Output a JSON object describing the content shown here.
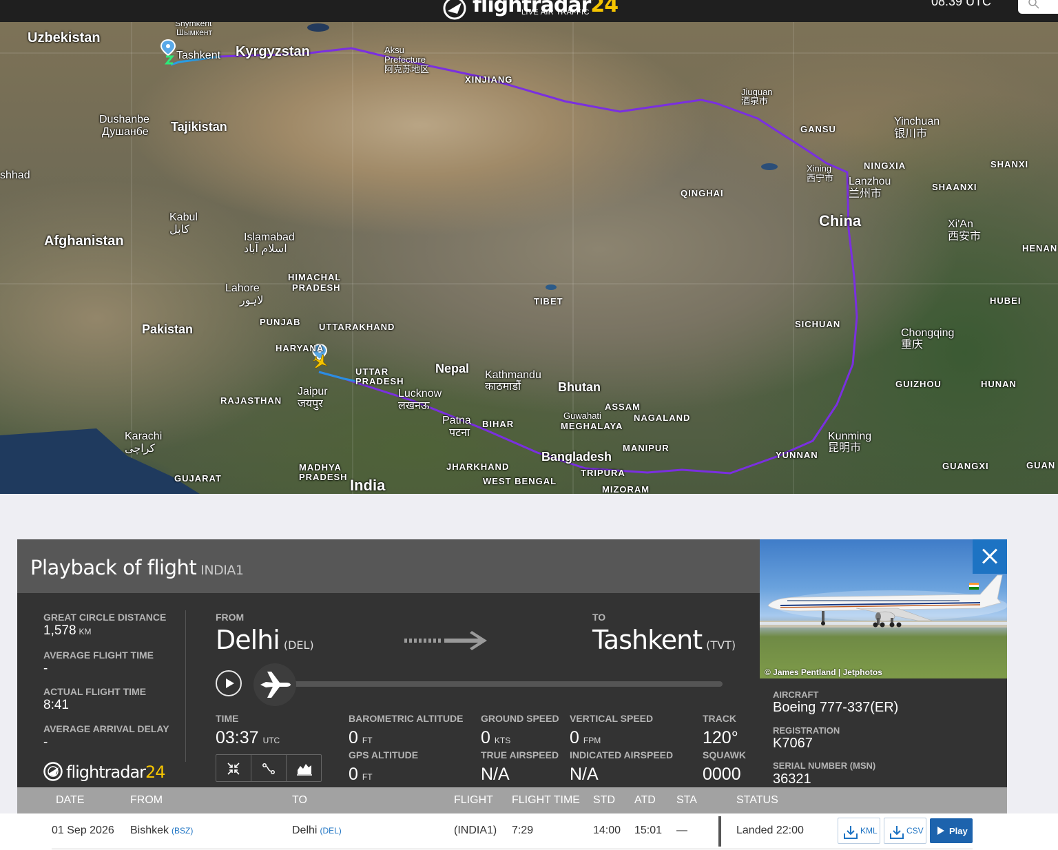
{
  "header": {
    "logo_main": "flightradar",
    "logo_num": "24",
    "logo_sub": "LIVE AIR TRAFFIC",
    "utc_time": "08:39 UTC"
  },
  "map": {
    "labels": {
      "uzbekistan": "Uzbekistan",
      "shymkent": "Shymkent",
      "shymkent_ru": "Шымкент",
      "tashkent": "Tashkent",
      "kyrgyzstan": "Kyrgyzstan",
      "aksu": "Aksu",
      "aksu_pref": "Prefecture",
      "aksu_cn": "阿克苏地区",
      "xinjiang": "XINJIANG",
      "jiuquan": "Jiuquan",
      "jiuquan_cn": "酒泉市",
      "gansu": "GANSU",
      "yinchuan": "Yinchuan",
      "yinchuan_cn": "银川市",
      "dushanbe": "Dushanbe",
      "dushanbe_ru": "Душанбе",
      "tajikistan": "Tajikistan",
      "xining": "Xining",
      "xining_cn": "西宁市",
      "ningxia": "NINGXIA",
      "lanzhou": "Lanzhou",
      "lanzhou_cn": "兰州市",
      "shanxi": "SHANXI",
      "shaanxi": "SHAANXI",
      "mashhad": "shhad",
      "qinghai": "QINGHAI",
      "china": "China",
      "xian": "Xi'An",
      "xian_cn": "西安市",
      "henan": "HENAN",
      "kabul": "Kabul",
      "kabul_local": "کابل",
      "afghanistan": "Afghanistan",
      "islamabad": "Islamabad",
      "islamabad_local": "اسلام آباد",
      "himachal": "HIMACHAL",
      "pradesh1": "PRADESH",
      "lahore": "Lahore",
      "lahore_local": "لاہور",
      "tibet": "TIBET",
      "hubei": "HUBEI",
      "punjab": "PUNJAB",
      "uttarakhand": "UTTARAKHAND",
      "pakistan": "Pakistan",
      "sichuan": "SICHUAN",
      "chongqing": "Chongqing",
      "chongqing_cn": "重庆",
      "haryana": "HARYANA",
      "uttar": "UTTAR",
      "pradesh2": "PRADESH",
      "nepal": "Nepal",
      "kathmandu": "Kathmandu",
      "kathmandu_local": "काठमाडौं",
      "bhutan": "Bhutan",
      "rajasthan": "RAJASTHAN",
      "jaipur": "Jaipur",
      "jaipur_local": "जयपुर",
      "lucknow": "Lucknow",
      "lucknow_local": "लखनऊ",
      "guizhou": "GUIZHOU",
      "hunan": "HUNAN",
      "assam": "ASSAM",
      "guwahati": "Guwahati",
      "nagaland": "NAGALAND",
      "meghalaya": "MEGHALAYA",
      "karachi": "Karachi",
      "karachi_local": "کراچی",
      "patna": "Patna",
      "patna_local": "पटना",
      "bihar": "BIHAR",
      "kunming": "Kunming",
      "kunming_cn": "昆明市",
      "manipur": "MANIPUR",
      "bangladesh": "Bangladesh",
      "yunnan": "YUNNAN",
      "guangxi": "GUANGXI",
      "guang": "GUAN",
      "madhya": "MADHYA",
      "pradesh3": "PRADESH",
      "jharkhand": "JHARKHAND",
      "tripura": "TRIPURA",
      "gujarat": "GUJARAT",
      "india": "India",
      "west_bengal": "WEST BENGAL",
      "mizoram": "MIZORAM"
    }
  },
  "panel": {
    "title": "Playback of flight",
    "flight_id": "INDIA1",
    "stats": [
      {
        "label": "GREAT CIRCLE DISTANCE",
        "value": "1,578",
        "unit": "KM"
      },
      {
        "label": "AVERAGE FLIGHT TIME",
        "value": "-",
        "unit": ""
      },
      {
        "label": "ACTUAL FLIGHT TIME",
        "value": "8:41",
        "unit": ""
      },
      {
        "label": "AVERAGE ARRIVAL DELAY",
        "value": "-",
        "unit": ""
      }
    ],
    "brand": {
      "main": "flightradar",
      "num": "24"
    },
    "from_label": "FROM",
    "from_city": "Delhi",
    "from_code": "(DEL)",
    "to_label": "TO",
    "to_city": "Tashkent",
    "to_code": "(TVT)",
    "playback_progress": 0,
    "telemetry": {
      "time_label": "TIME",
      "time_value": "03:37",
      "time_unit": "UTC",
      "baro_label": "BAROMETRIC ALTITUDE",
      "baro_value": "0",
      "baro_unit": "FT",
      "gps_label": "GPS ALTITUDE",
      "gps_value": "0",
      "gps_unit": "FT",
      "gs_label": "GROUND SPEED",
      "gs_value": "0",
      "gs_unit": "KTS",
      "tas_label": "TRUE AIRSPEED",
      "tas_value": "N/A",
      "vs_label": "VERTICAL SPEED",
      "vs_value": "0",
      "vs_unit": "FPM",
      "ias_label": "INDICATED AIRSPEED",
      "ias_value": "N/A",
      "track_label": "TRACK",
      "track_value": "120°",
      "squawk_label": "SQUAWK",
      "squawk_value": "0000"
    },
    "photo_credit": "© James Pentland | Jetphotos",
    "aircraft": [
      {
        "label": "AIRCRAFT",
        "value": "Boeing 777-337(ER)"
      },
      {
        "label": "REGISTRATION",
        "value": "K7067"
      },
      {
        "label": "SERIAL NUMBER (MSN)",
        "value": "36321"
      }
    ]
  },
  "table": {
    "headers": [
      "DATE",
      "FROM",
      "TO",
      "FLIGHT",
      "FLIGHT TIME",
      "STD",
      "ATD",
      "STA",
      "STATUS"
    ],
    "rows": [
      {
        "date": "01 Sep 2026",
        "from": "Bishkek",
        "from_code": "(BSZ)",
        "to": "Delhi",
        "to_code": "(DEL)",
        "flight": "(INDIA1)",
        "flight_time": "7:29",
        "std": "14:00",
        "atd": "15:01",
        "sta": "—",
        "status": "Landed 22:00",
        "kml_label": "KML",
        "csv_label": "CSV",
        "play_label": "Play"
      }
    ]
  },
  "colors": {
    "route": "#7a2fe0",
    "accent": "#1d73c3",
    "brand_yellow": "#f5c400",
    "panel_bg": "#333333"
  }
}
